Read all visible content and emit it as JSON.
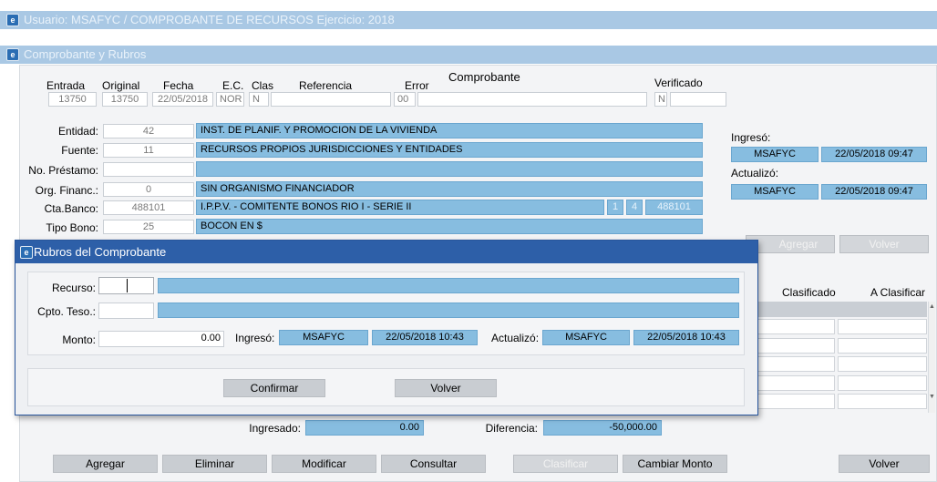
{
  "window": {
    "title": "Usuario: MSAFYC  /  COMPROBANTE DE RECURSOS  Ejercicio: 2018"
  },
  "section": {
    "title": "Comprobante y Rubros"
  },
  "header": {
    "comprobante_title": "Comprobante",
    "labels": {
      "entrada": "Entrada",
      "original": "Original",
      "fecha": "Fecha",
      "ec": "E.C.",
      "clas": "Clas",
      "referencia": "Referencia",
      "error": "Error",
      "verificado": "Verificado"
    },
    "values": {
      "entrada": "13750",
      "original": "13750",
      "fecha": "22/05/2018",
      "ec": "NOR",
      "clas": "N",
      "referencia": "",
      "error": "00",
      "verificado": "N"
    }
  },
  "details": {
    "entidad": {
      "label": "Entidad:",
      "code": "42",
      "desc": "INST. DE PLANIF. Y PROMOCION DE LA VIVIENDA"
    },
    "fuente": {
      "label": "Fuente:",
      "code": "11",
      "desc": "RECURSOS PROPIOS JURISDICCIONES Y ENTIDADES"
    },
    "prestamo": {
      "label": "No. Préstamo:",
      "code": "",
      "desc": ""
    },
    "org_financ": {
      "label": "Org. Financ.:",
      "code": "0",
      "desc": "SIN ORGANISMO FINANCIADOR"
    },
    "cta_banco": {
      "label": "Cta.Banco:",
      "code": "488101",
      "desc": "I.P.P.V. - COMITENTE BONOS RIO I - SERIE II",
      "extra1": "1",
      "extra2": "4",
      "extra3": "488101"
    },
    "tipo_bono": {
      "label": "Tipo Bono:",
      "code": "25",
      "desc": "BOCON EN $"
    }
  },
  "audit": {
    "ingreso_label": "Ingresó:",
    "ingreso_user": "MSAFYC",
    "ingreso_date": "22/05/2018 09:47",
    "actualizo_label": "Actualizó:",
    "actualizo_user": "MSAFYC",
    "actualizo_date": "22/05/2018 09:47"
  },
  "right_buttons": {
    "agregar": "Agregar",
    "volver": "Volver"
  },
  "right_table": {
    "col1": "Clasificado",
    "col2": "A Clasificar"
  },
  "dialog": {
    "title": "Rubros del Comprobante",
    "recurso_label": "Recurso:",
    "cpto_label": "Cpto. Teso.:",
    "monto_label": "Monto:",
    "monto_value": "0.00",
    "ingreso_label": "Ingresó:",
    "ingreso_user": "MSAFYC",
    "ingreso_date": "22/05/2018 10:43",
    "actualizo_label": "Actualizó:",
    "actualizo_user": "MSAFYC",
    "actualizo_date": "22/05/2018 10:43",
    "confirmar": "Confirmar",
    "volver": "Volver"
  },
  "totals": {
    "ingresado_label": "Ingresado:",
    "ingresado_value": "0.00",
    "diferencia_label": "Diferencia:",
    "diferencia_value": "-50,000.00"
  },
  "bottom_buttons": {
    "agregar": "Agregar",
    "eliminar": "Eliminar",
    "modificar": "Modificar",
    "consultar": "Consultar",
    "clasificar": "Clasificar",
    "cambiar_monto": "Cambiar Monto",
    "volver": "Volver"
  }
}
